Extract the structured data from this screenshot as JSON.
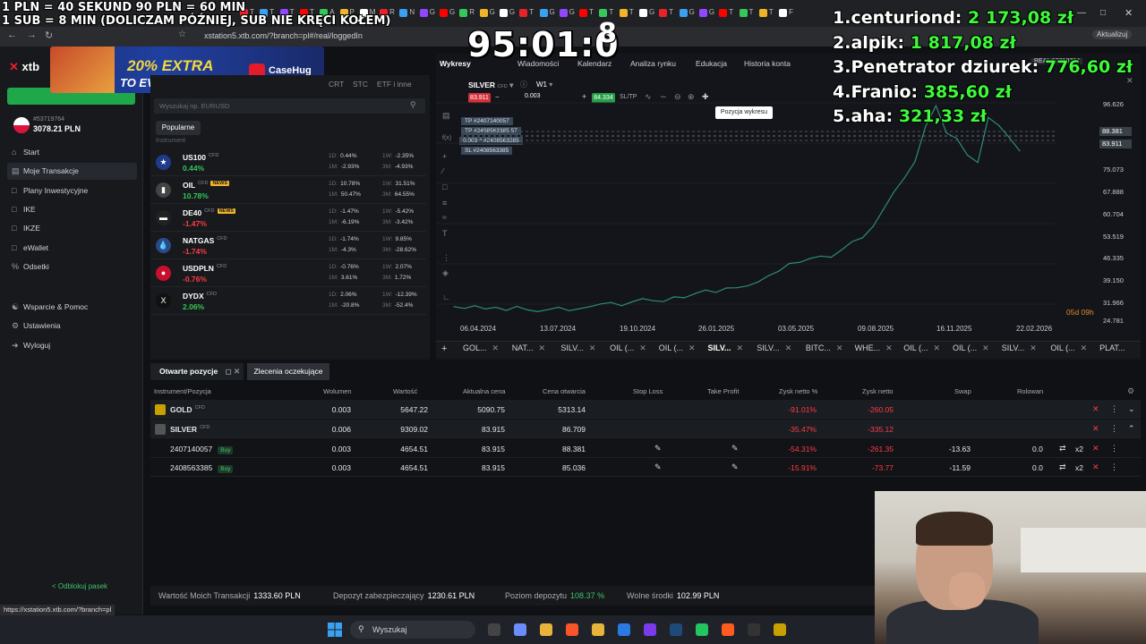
{
  "browser": {
    "url": "xstation5.xtb.com/?branch=pl#/real/loggedIn",
    "status_url": "https://xstation5.xtb.com/?branch=pl",
    "update_label": "Aktualizuj",
    "tabs": [
      "T",
      "T",
      "T",
      "T",
      "A",
      "P",
      "M",
      "R",
      "N",
      "G",
      "G",
      "R",
      "G",
      "G",
      "T",
      "G",
      "G",
      "T",
      "T",
      "T",
      "G",
      "T",
      "G",
      "G",
      "T",
      "T",
      "T",
      "F"
    ]
  },
  "overlay": {
    "line1": "1 PLN =  40 SEKUND 90 PLN = 60 MIN",
    "line2": "1 SUB = 8 MIN (DOLICZAM PÓŹNIEJ, SUB NIE KRĘCI KOŁEM)",
    "timer": "95:01:0",
    "timer_sup": "8",
    "leaderboard": [
      {
        "rank": "1.",
        "name": "centuriond:",
        "amount": "2 173,08 zł"
      },
      {
        "rank": "2.",
        "name": "alpik:",
        "amount": "1 817,08 zł"
      },
      {
        "rank": "3.",
        "name": "Penetrator dziurek:",
        "amount": "776,60 zł"
      },
      {
        "rank": "4.",
        "name": "Franio:",
        "amount": "385,60 zł"
      },
      {
        "rank": "5.",
        "name": "aha:",
        "amount": "321,33 zł"
      }
    ],
    "promo": {
      "line1": "20% EXTRA",
      "line2": "TO EVERY TOP-UP",
      "brand": "CaseHug"
    }
  },
  "sidebar": {
    "logo": "xtb",
    "account_id": "#53719764",
    "balance": "3078.21 PLN",
    "items": [
      {
        "label": "Start",
        "icon": "home-icon"
      },
      {
        "label": "Moje Transakcje",
        "icon": "chart-icon",
        "active": true
      },
      {
        "label": "Plany Inwestycyjne",
        "icon": "plan-icon"
      },
      {
        "label": "IKE",
        "icon": "ike-icon"
      },
      {
        "label": "IKZE",
        "icon": "ikze-icon"
      },
      {
        "label": "eWallet",
        "icon": "wallet-icon"
      },
      {
        "label": "Odsetki",
        "icon": "percent-icon"
      }
    ],
    "items2": [
      {
        "label": "Wsparcie & Pomoc",
        "icon": "help-icon"
      },
      {
        "label": "Ustawienia",
        "icon": "gear-icon"
      },
      {
        "label": "Wyloguj",
        "icon": "logout-icon"
      }
    ],
    "unlock": "Odblokuj pasek"
  },
  "instruments": {
    "tabs": [
      "CRT",
      "STC",
      "ETF i inne"
    ],
    "search_placeholder": "Wyszukaj np. EURUSD",
    "popular": "Popularne",
    "col_label": "Instrument",
    "rows": [
      {
        "name": "US100",
        "news": false,
        "change": "0.44%",
        "dir": "pos",
        "d1": "0.44%",
        "m1": "-2.93%",
        "w1": "-2.35%",
        "m3": "-4.93%"
      },
      {
        "name": "OIL",
        "news": true,
        "change": "10.78%",
        "dir": "pos",
        "d1": "10.78%",
        "m1": "50.47%",
        "w1": "31.51%",
        "m3": "64.55%"
      },
      {
        "name": "DE40",
        "news": true,
        "change": "-1.47%",
        "dir": "neg",
        "d1": "-1.47%",
        "m1": "-6.19%",
        "w1": "-5.42%",
        "m3": "-3.42%"
      },
      {
        "name": "NATGAS",
        "news": false,
        "change": "-1.74%",
        "dir": "neg",
        "d1": "-1.74%",
        "m1": "-4.3%",
        "w1": "9.85%",
        "m3": "-28.62%"
      },
      {
        "name": "USDPLN",
        "news": false,
        "change": "-0.76%",
        "dir": "neg",
        "d1": "-0.76%",
        "m1": "3.61%",
        "w1": "2.07%",
        "m3": "1.72%"
      },
      {
        "name": "DYDX",
        "news": false,
        "change": "2.06%",
        "dir": "pos",
        "d1": "2.06%",
        "m1": "-20.8%",
        "w1": "-12.39%",
        "m3": "-52.4%"
      }
    ],
    "cfd": "CFD",
    "news_label": "NEWS",
    "lbl_1d": "1D:",
    "lbl_1m": "1M:",
    "lbl_1w": "1W:",
    "lbl_3m": "3M:"
  },
  "chart_tabs_top": [
    "Wykresy",
    "Wiadomości",
    "Kalendarz",
    "Analiza rynku",
    "Edukacja",
    "Historia konta"
  ],
  "chart_header": {
    "symbol": "SILVER",
    "timeframe": "W1",
    "sell": "83.911",
    "buy": "84.334",
    "qty": "0.003",
    "sltp": "SL/TP",
    "tooltip": "Pozycja wykresu",
    "real": "REAL 53719764",
    "countdown": "05d 09h"
  },
  "order_tags": [
    {
      "label": "TP  #2407140057"
    },
    {
      "label": "TP  #2408563385  57"
    },
    {
      "label": "0.003  ^  #2408563385"
    },
    {
      "label": "SL  #2408563385"
    }
  ],
  "chart_data": {
    "type": "line",
    "series": [
      {
        "values": [
          31.2,
          30.6,
          31.5,
          30.4,
          31.0,
          29.9,
          31.3,
          30.1,
          29.5,
          30.2,
          31.0,
          29.8,
          30.5,
          31.2,
          32.1,
          32.6,
          31.5,
          32.8,
          33.9,
          33.2,
          32.9,
          34.5,
          34.2,
          35.6,
          36.8,
          36.0,
          37.5,
          37.6,
          38.2,
          39.5,
          41.6,
          43.2,
          45.8,
          46.2,
          47.5,
          48.3,
          47.9,
          50.4,
          53.2,
          54.5,
          58.3,
          64.2,
          70.1,
          74.8,
          80.3,
          92.1,
          99.2,
          90.0,
          88.1,
          82.5,
          80.0,
          95.2,
          92.5,
          88.4,
          83.9
        ]
      }
    ],
    "x_labels": [
      "06.04.2024",
      "13.07.2024",
      "19.10.2024",
      "26.01.2025",
      "03.05.2025",
      "09.08.2025",
      "16.11.2025",
      "22.02.2026"
    ],
    "y_labels": [
      "96.626",
      "89.801",
      "83.911",
      "75.073",
      "67.888",
      "60.704",
      "53.519",
      "46.335",
      "39.150",
      "31.966",
      "24.781"
    ],
    "price_labels": [
      "88.381",
      "83.911"
    ],
    "ylim": [
      24.781,
      103.8
    ]
  },
  "bottom_chart_tabs": [
    "GOL...",
    "NAT...",
    "SILV...",
    "OIL (...",
    "OIL (...",
    "SILV...",
    "SILV...",
    "BITC...",
    "WHE...",
    "OIL (...",
    "OIL (...",
    "SILV...",
    "OIL (...",
    "PLAT..."
  ],
  "positions": {
    "tab_open": "Otwarte pozycje",
    "tab_pending": "Zlecenia oczekujące",
    "headers": [
      "Instrument/Pozycja",
      "Wolumen",
      "Wartość",
      "Aktualna cena",
      "Cena otwarcia",
      "Stop Loss",
      "Take Profit",
      "Zysk netto %",
      "Zysk netto",
      "Swap",
      "Rolowan"
    ],
    "rows": [
      {
        "name": "GOLD",
        "cfd": "CFD",
        "vol": "0.003",
        "value": "5647.22",
        "price": "5090.75",
        "open": "5313.14",
        "pct": "-91.01%",
        "profit": "-260.05",
        "swap": ""
      },
      {
        "name": "SILVER",
        "cfd": "CFD",
        "vol": "0.006",
        "value": "9309.02",
        "price": "83.915",
        "open": "86.709",
        "pct": "-35.47%",
        "profit": "-335.12",
        "swap": ""
      },
      {
        "name": "2407140057",
        "badge": "Buy",
        "vol": "0.003",
        "value": "4654.51",
        "price": "83.915",
        "open": "88.381",
        "pct": "-54.31%",
        "profit": "-261.35",
        "swap": "-13.63",
        "roll": "0.0",
        "mult": "x2"
      },
      {
        "name": "2408563385",
        "badge": "Buy",
        "vol": "0.003",
        "value": "4654.51",
        "price": "83.915",
        "open": "85.036",
        "pct": "-15.91%",
        "profit": "-73.77",
        "swap": "-11.59",
        "roll": "0.0",
        "mult": "x2"
      }
    ]
  },
  "footer": [
    {
      "label": "Wartość Moich Transakcji",
      "value": "1333.60  PLN"
    },
    {
      "label": "Depozyt zabezpieczający",
      "value": "1230.61  PLN"
    },
    {
      "label": "Poziom depozytu",
      "value": "108.37 %",
      "accent": true
    },
    {
      "label": "Wolne środki",
      "value": "102.99  PLN"
    }
  ],
  "taskbar": {
    "search": "Wyszukaj"
  }
}
